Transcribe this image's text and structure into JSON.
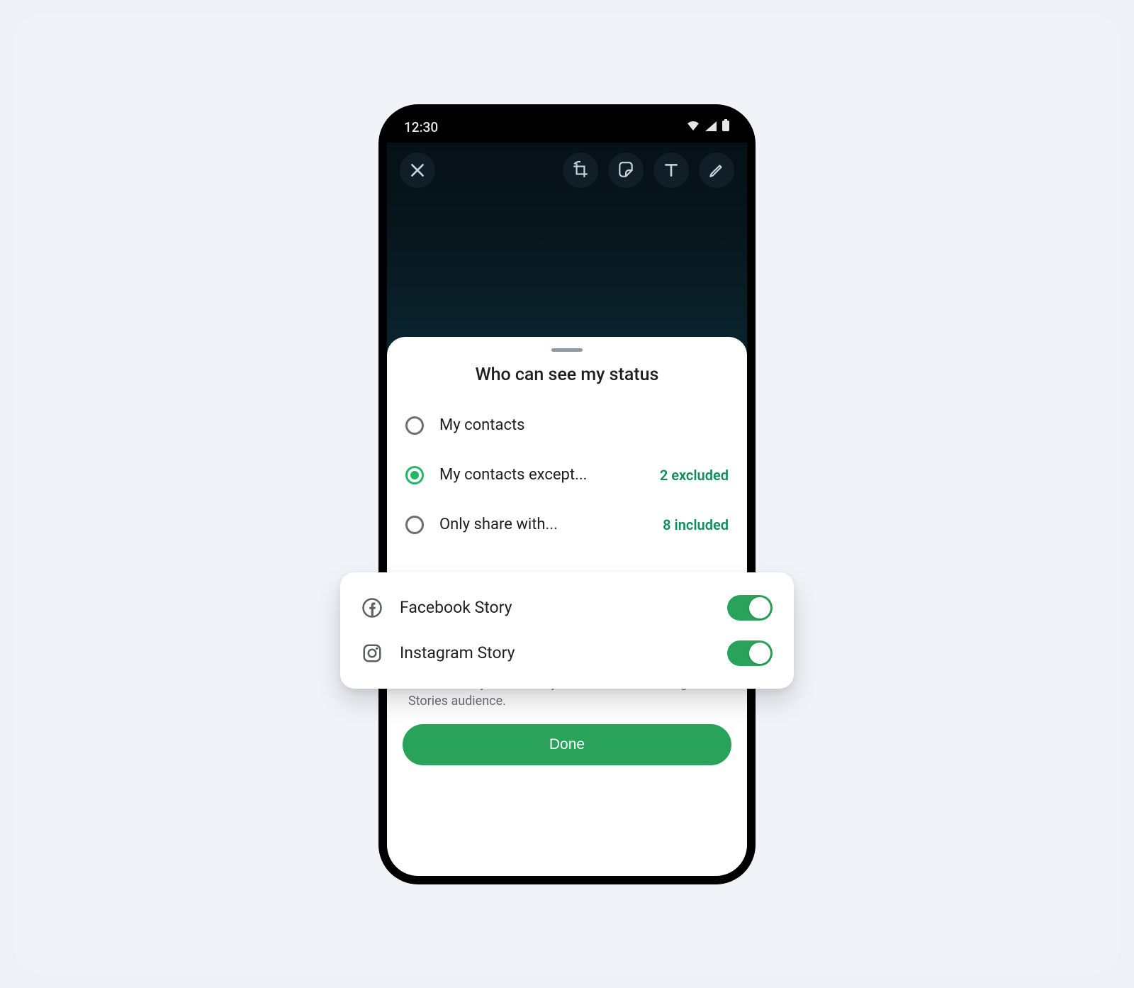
{
  "status_bar": {
    "time": "12:30"
  },
  "editor": {
    "tools": [
      "close",
      "crop-rotate",
      "sticker",
      "text",
      "draw"
    ]
  },
  "sheet": {
    "title": "Who can see my status",
    "options": [
      {
        "label": "My contacts",
        "selected": false,
        "badge": ""
      },
      {
        "label": "My contacts except...",
        "selected": true,
        "badge": "2 excluded"
      },
      {
        "label": "Only share with...",
        "selected": false,
        "badge": "8 included"
      }
    ],
    "share_desc": "Automatically share with your Facebook or Instagram Stories audience.",
    "done_label": "Done"
  },
  "share_card": {
    "rows": [
      {
        "icon": "facebook",
        "label": "Facebook Story",
        "on": true
      },
      {
        "icon": "instagram",
        "label": "Instagram Story",
        "on": true
      }
    ]
  },
  "colors": {
    "accent": "#29a35a",
    "badge": "#0e8f5b"
  }
}
